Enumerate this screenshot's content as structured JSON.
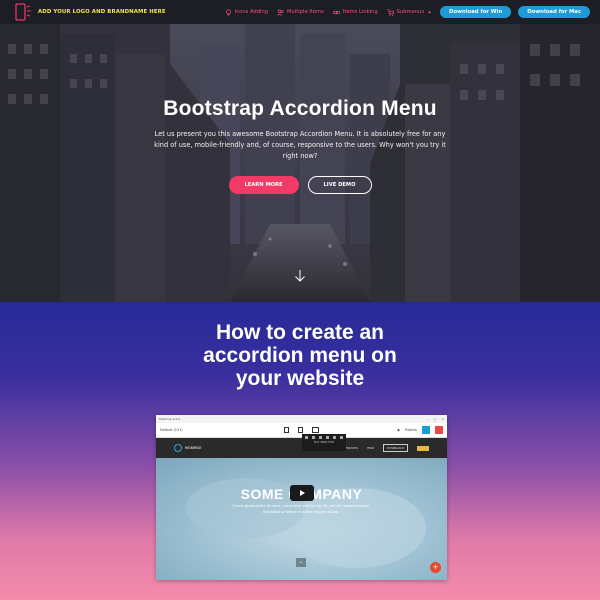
{
  "navbar": {
    "brand_text": "ADD YOUR LOGO AND BRANDNAME HERE",
    "links": [
      {
        "label": "Icons Adding",
        "icon": "bulb-icon"
      },
      {
        "label": "Multiple Items",
        "icon": "users-icon"
      },
      {
        "label": "Items Linking",
        "icon": "link-icon"
      },
      {
        "label": "Submenus",
        "icon": "cart-icon"
      }
    ],
    "download_win": "Download for Win",
    "download_mac": "Download for Mac"
  },
  "hero": {
    "title": "Bootstrap Accordion Menu",
    "subtitle": "Let us present you this awesome Bootstrap Accordion Menu. It is absolutely free for any kind of use, mobile-friendly and, of course, responsive to the users. Why won't you try it right now?",
    "learn_more": "LEARN MORE",
    "live_demo": "LIVE DEMO"
  },
  "section2": {
    "title": "How to create an accordion menu on your website"
  },
  "screenshot": {
    "window_title": "Mobirise 4.0.0",
    "project_name": "Default (101)",
    "publish": "Publish",
    "brand": "MOBIRISE",
    "nav_items": [
      "ABOUT US",
      "SERVICES",
      "HELP",
      "DOWNLOAD"
    ],
    "heading": "SOME COMPANY",
    "subtext": "Lorem ipsum dolor sit amet, consectetur adipiscing elit, sed do eiusmod tempor incididunt ut labore et dolore magna aliqua.",
    "popup_label": "EDIT MENU ITEM"
  },
  "colors": {
    "nav_bg": "#1d1d25",
    "brand_yellow": "#f3e54a",
    "nav_link": "#ff4d7a",
    "download_blue": "#1e9bd7",
    "learn_more_bg": "#f23a66"
  }
}
